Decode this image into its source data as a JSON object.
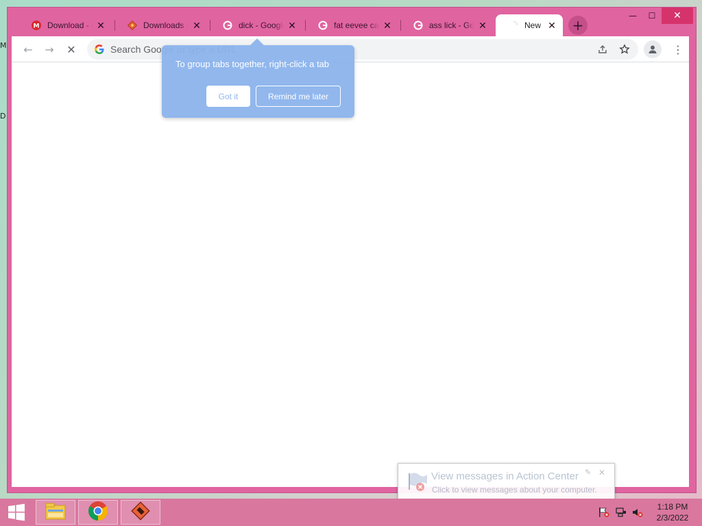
{
  "desktop": {
    "glyph_top": "M",
    "glyph_mid": "D"
  },
  "browser": {
    "tabs": [
      {
        "label": "Download - M",
        "favicon": "mega-icon"
      },
      {
        "label": "Downloads - u",
        "favicon": "diamond-icon"
      },
      {
        "label": "dick - Google",
        "favicon": "google-icon"
      },
      {
        "label": "fat eevee caro",
        "favicon": "google-icon"
      },
      {
        "label": "ass lick - Goo",
        "favicon": "google-icon"
      },
      {
        "label": "New T",
        "favicon": "loading-icon",
        "active": true
      }
    ],
    "close_glyph": "✕",
    "new_tab_glyph": "+",
    "window_controls": {
      "minimize": "—",
      "maximize": "☐",
      "close": "✕"
    },
    "omnibox": {
      "placeholder": "Search Google or type a URL",
      "value": ""
    },
    "nav": {
      "back": "←",
      "forward": "→",
      "stop": "✕"
    },
    "menu_glyph": "⋮",
    "accent_color": "#e064a0"
  },
  "tab_group_hint": {
    "text": "To group tabs together, right-click a tab",
    "got_it": "Got it",
    "remind_later": "Remind me later",
    "color": "#8cb4ed"
  },
  "notification": {
    "title": "View messages in Action Center",
    "body": "Click to view messages about your computer.",
    "close": "✕",
    "pin": "✎"
  },
  "taskbar": {
    "items": [
      "file-explorer-icon",
      "chrome-icon",
      "app-icon"
    ],
    "time": "1:18 PM",
    "date": "2/3/2022",
    "color": "#d9779f"
  }
}
